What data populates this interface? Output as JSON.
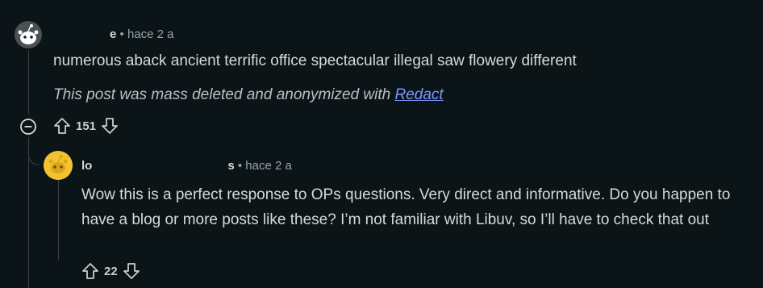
{
  "comments": [
    {
      "author": "",
      "author_tail": "e",
      "separator": "•",
      "timestamp": "hace 2 a",
      "body": "numerous aback ancient terrific office spectacular illegal saw flowery different",
      "note_prefix": "This post was mass deleted and anonymized with ",
      "note_link": "Redact",
      "votes": "151"
    },
    {
      "author": "lo",
      "author_tail": "s",
      "separator": "•",
      "timestamp": "hace 2 a",
      "body": "Wow this is a perfect response to OPs questions. Very direct and informative. Do you happen to have a blog or more posts like these? I’m not familiar with Libuv, so I’ll have to check that out",
      "votes": "22"
    }
  ],
  "icons": {
    "collapse": "collapse-minus-icon",
    "upvote": "upvote-arrow-icon",
    "downvote": "downvote-arrow-icon",
    "avatar": "snoo-avatar-icon"
  },
  "colors": {
    "background": "#0b1416",
    "text": "#d7dadc",
    "meta": "#9aa3a6",
    "link": "#7b97ff",
    "avatar2": "#f2c230"
  }
}
